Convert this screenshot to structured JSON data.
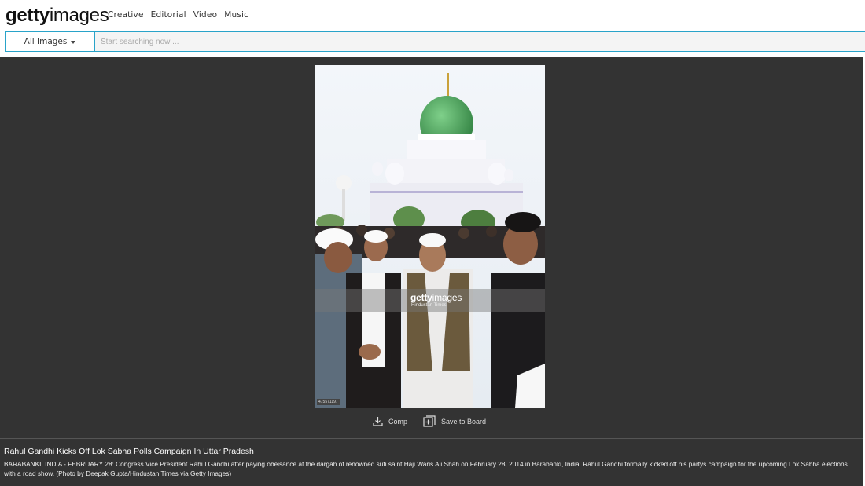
{
  "brand": {
    "bold": "getty",
    "light": "images"
  },
  "nav": [
    "Creative",
    "Editorial",
    "Video",
    "Music"
  ],
  "search": {
    "scope_label": "All Images",
    "placeholder": "Start searching now ..."
  },
  "image": {
    "watermark_logo_bold": "getty",
    "watermark_logo_light": "images",
    "watermark_credit": "Hindustan Times",
    "image_id": "475571197"
  },
  "actions": {
    "comp_label": "Comp",
    "save_label": "Save to Board"
  },
  "caption": {
    "title": "Rahul Gandhi Kicks Off Lok Sabha Polls Campaign In Uttar Pradesh",
    "description": "BARABANKI, INDIA - FEBRUARY 28: Congress Vice President Rahul Gandhi after paying obeisance at the dargah of renowned sufi saint Haji Waris Ali Shah on February 28, 2014 in Barabanki, India. Rahul Gandhi formally kicked off his partys campaign for the upcoming Lok Sabha elections with a road show. (Photo by Deepak Gupta/Hindustan Times via Getty Images)"
  },
  "colors": {
    "accent": "#29a3c9",
    "viewer_bg": "#333333",
    "dome": "#3e9a4e"
  },
  "icons": {
    "comp": "download-icon",
    "save": "add-to-board-icon",
    "scope": "caret-down-icon"
  }
}
